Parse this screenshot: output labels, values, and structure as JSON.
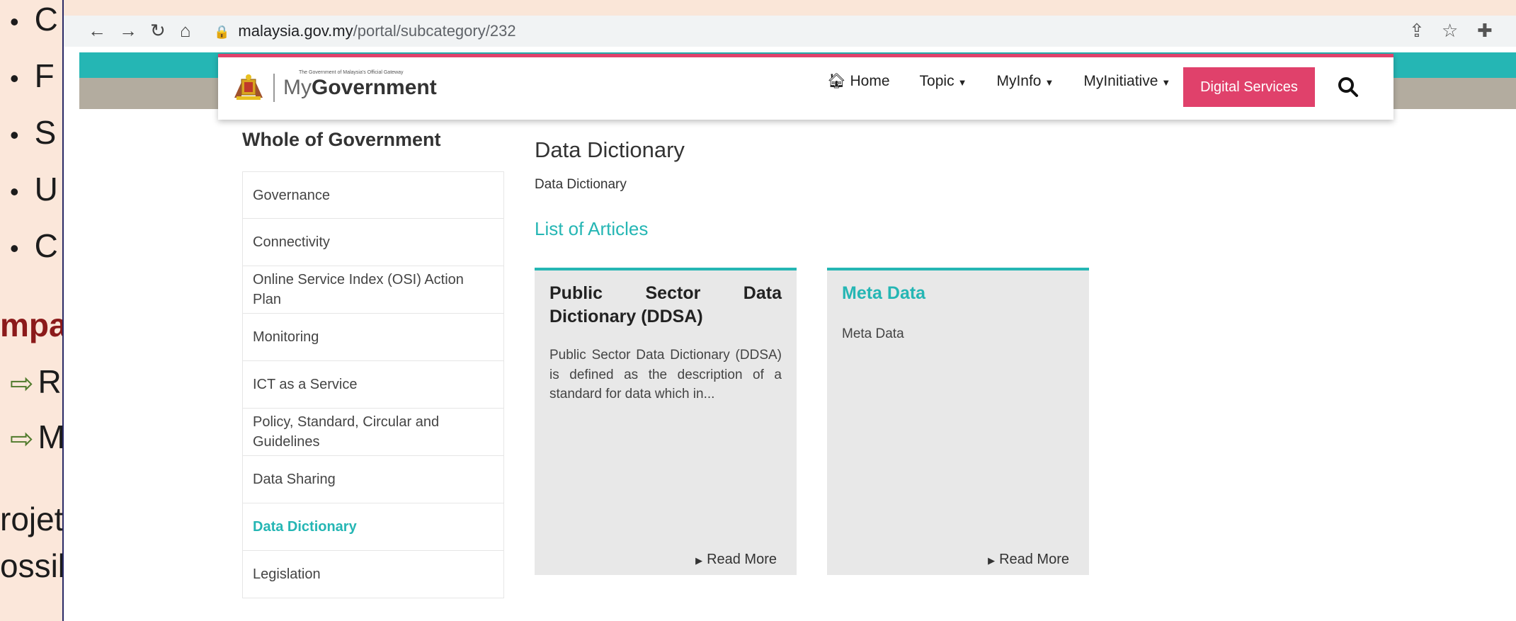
{
  "slide": {
    "bullets": [
      "C",
      "F",
      "S",
      "U",
      "C"
    ],
    "heading": "mpa",
    "arrow_items": [
      "R",
      "M"
    ],
    "bottom_lines": [
      "rojet",
      "ossib"
    ],
    "arrow_glyph": "⇨",
    "bullet_glyph": "•"
  },
  "browser": {
    "url_domain": "malaysia.gov.my",
    "url_path": "/portal/subcategory/232",
    "icons": [
      "back-icon",
      "forward-icon",
      "reload-icon",
      "home-icon",
      "lock-icon",
      "share-icon",
      "star-icon",
      "extension-icon"
    ]
  },
  "header": {
    "logo_tagline": "The Government of Malaysia's Official Gateway",
    "logo_my": "My",
    "logo_gov": "Government",
    "menu": {
      "home": "Home",
      "topic": "Topic",
      "myinfo": "MyInfo",
      "myinitiative": "MyInitiative"
    },
    "digital_services": "Digital Services",
    "accent": "#e0416b"
  },
  "sidebar": {
    "title": "Whole of Government",
    "items": [
      {
        "label": "Governance"
      },
      {
        "label": "Connectivity"
      },
      {
        "label": "Online Service Index (OSI) Action Plan"
      },
      {
        "label": "Monitoring"
      },
      {
        "label": "ICT as a Service"
      },
      {
        "label": "Policy, Standard, Circular and Guidelines"
      },
      {
        "label": "Data Sharing"
      },
      {
        "label": "Data Dictionary",
        "active": true
      },
      {
        "label": "Legislation"
      }
    ]
  },
  "main": {
    "title": "Data Dictionary",
    "subtitle": "Data Dictionary",
    "list_title": "List of Articles",
    "teal": "#25b6b4",
    "cards": [
      {
        "title": "Public Sector Data Dictionary (DDSA)",
        "description": "Public Sector Data Dictionary (DDSA) is defined as the description of a standard for data which in...",
        "read_more": "Read More"
      },
      {
        "title": "Meta Data",
        "description": "Meta Data",
        "read_more": "Read More"
      }
    ]
  }
}
